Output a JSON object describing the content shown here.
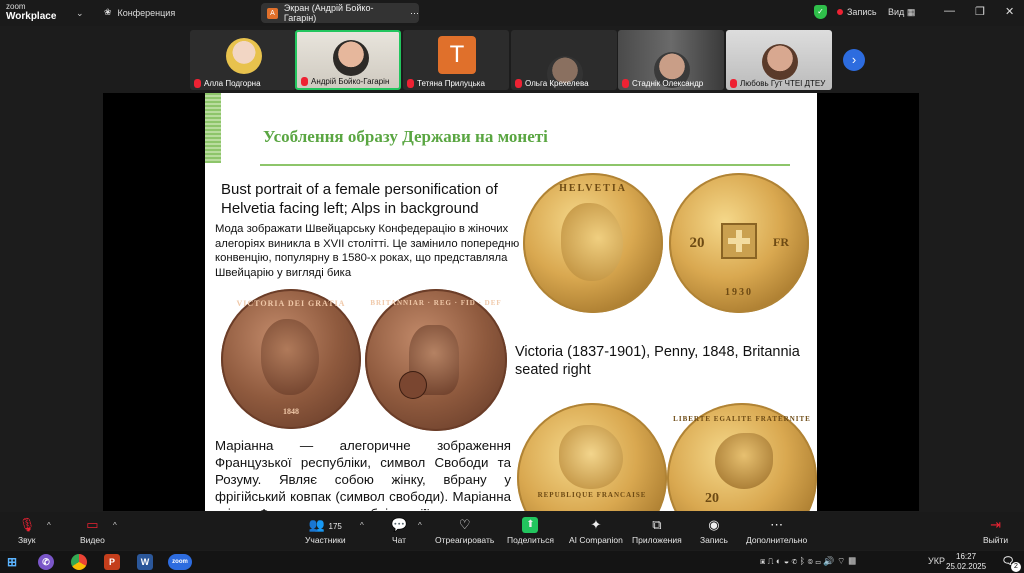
{
  "app": {
    "logo_top": "zoom",
    "logo_bottom": "Workplace",
    "meeting_tab": "Конференция"
  },
  "share_pill": {
    "badge": "A",
    "label": "Экран (Андрій Бойко-Гагарін)"
  },
  "recording": {
    "label": "Запись"
  },
  "view_label": "Вид",
  "participants": [
    {
      "name": "Алла Подгорна",
      "muted": true
    },
    {
      "name": "Андрій Бойко-Гагарін",
      "muted": true,
      "active": true
    },
    {
      "name": "Тетяна Прилуцька",
      "muted": true,
      "avatar_letter": "T"
    },
    {
      "name": "Ольга Крехелева",
      "muted": true
    },
    {
      "name": "Стаднік Олександр",
      "muted": true
    },
    {
      "name": "Любовь Гут ЧТЕІ ДТЕУ",
      "muted": true
    }
  ],
  "slide": {
    "title": "Усоблення образу Держави на монеті",
    "helvetia_en": "Bust portrait of a female personification of Helvetia facing left; Alps in background",
    "helvetia_ua": "Мода зображати Швейцарську Конфедерацію в жіночих алегоріях виникла в XVII столітті. Це замінило попередню конвенцію, популярну в 1580-х роках, що представляла Швейцарію у вигляді бика",
    "victoria_en": "Victoria (1837-1901), Penny, 1848, Britannia seated right",
    "marianne_ua": "Маріанна — алегоричне зображення Французької республіки, символ Свободи та Розуму. Являє собою жінку, вбрану у фрігійський ковпак (символ свободи). Маріанна втілює Французьку республіку та її",
    "coin_helvetia": "HELVETIA",
    "coin_20": "20",
    "coin_fr": "FR",
    "coin_year_ch": "1930",
    "coin_victoria": "VICTORIA DEI GRATIA",
    "coin_year_uk": "1848",
    "coin_britannia": "BRITANNIAR · REG · FID · DEF",
    "coin_rf": "REPUBLIQUE FRANCAISE",
    "coin_liberte": "LIBERTE EGALITE FRATERNITE",
    "coin_20b": "20"
  },
  "toolbar": {
    "audio": "Звук",
    "video": "Видео",
    "participants": "Участники",
    "participants_count": "175",
    "chat": "Чат",
    "react": "Отреагировать",
    "share": "Поделиться",
    "ai": "AI Companion",
    "apps": "Приложения",
    "record": "Запись",
    "more": "Дополнительно",
    "leave": "Выйти"
  },
  "taskbar": {
    "lang": "УКР",
    "time": "16:27",
    "date": "25.02.2025",
    "notif_count": "2"
  },
  "colors": {
    "accent_green": "#5aa642",
    "zoom_blue": "#2d6cdf",
    "record_red": "#ee2233"
  }
}
